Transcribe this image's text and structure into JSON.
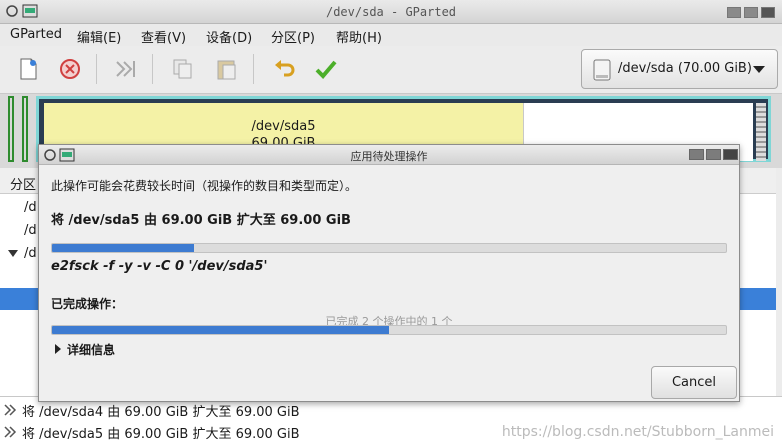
{
  "window": {
    "title": "/dev/sda - GParted"
  },
  "menu": [
    "GParted",
    "编辑(E)",
    "查看(V)",
    "设备(D)",
    "分区(P)",
    "帮助(H)"
  ],
  "toolbar": {
    "buttons": [
      "new-icon",
      "delete-icon",
      "resize-move-icon",
      "copy-icon",
      "paste-icon",
      "undo-icon",
      "apply-icon"
    ]
  },
  "device_selector": {
    "label": "/dev/sda (70.00 GiB)"
  },
  "partition_graph": {
    "name": "/dev/sda5",
    "size": "69.00 GiB"
  },
  "partition_list": {
    "header": "分区",
    "rows": [
      "/d",
      "/d",
      "/d"
    ]
  },
  "pending_ops": [
    {
      "text": "将 /dev/sda4 由 69.00 GiB 扩大至 69.00 GiB"
    },
    {
      "text": "将 /dev/sda5 由 69.00 GiB 扩大至 69.00 GiB"
    }
  ],
  "dialog": {
    "title": "应用待处理操作",
    "description": "此操作可能会花费较长时间（视操作的数目和类型而定）。",
    "current_task": "将 /dev/sda5 由 69.00 GiB 扩大至 69.00 GiB",
    "task_progress": 0.21,
    "command": "e2fsck -f -y -v -C 0 '/dev/sda5'",
    "completed_label": "已完成操作：",
    "completed_count": "已完成 2 个操作中的 1 个",
    "overall_progress": 0.5,
    "details_label": "详细信息",
    "cancel_label": "Cancel"
  },
  "watermark": "https://blog.csdn.net/Stubborn_Lanmei"
}
